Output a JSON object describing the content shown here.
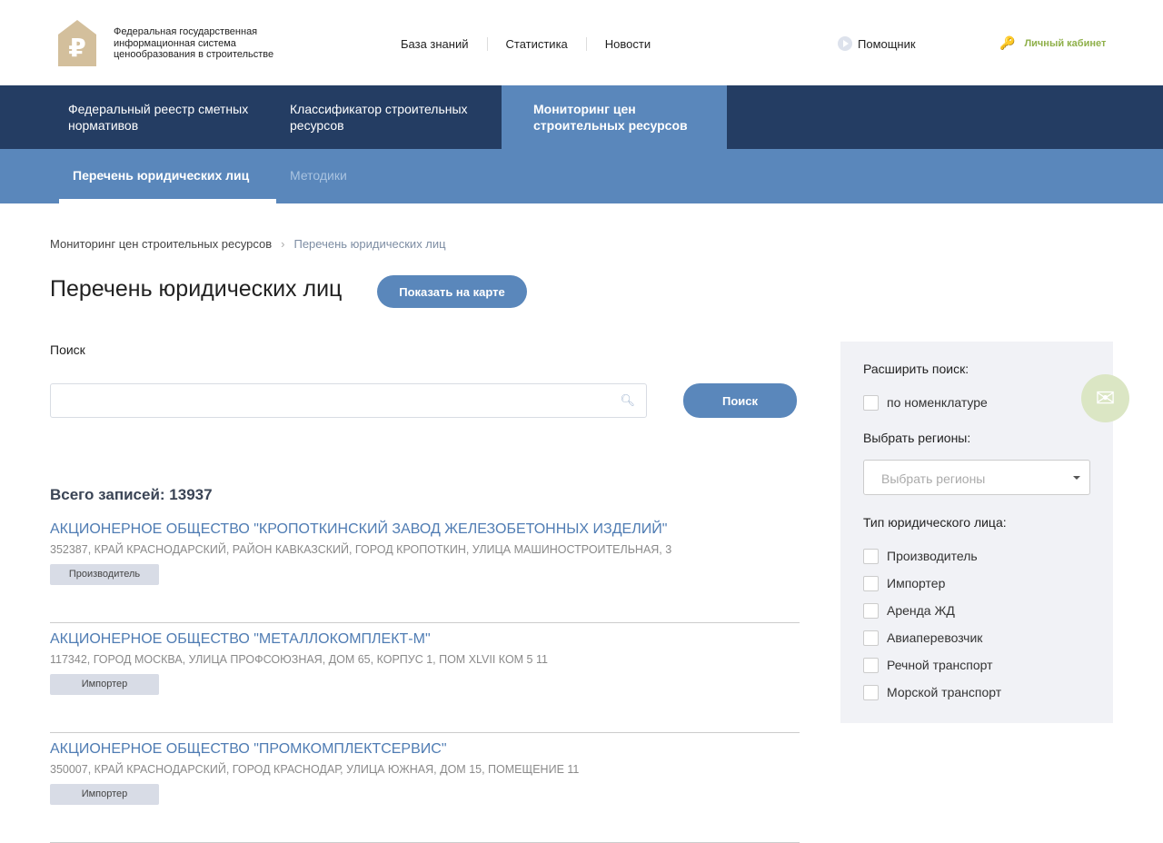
{
  "header": {
    "logo_text": "Федеральная государственная информационная система ценообразования в строительстве",
    "links": [
      "База знаний",
      "Статистика",
      "Новости"
    ],
    "helper": "Помощник",
    "cabinet": "Личный кабинет"
  },
  "nav": {
    "main": [
      "Федеральный реестр сметных нормативов",
      "Классификатор строительных ресурсов",
      "Мониторинг цен строительных ресурсов"
    ],
    "sub": [
      "Перечень юридических лиц",
      "Методики"
    ]
  },
  "breadcrumb": [
    "Мониторинг цен строительных ресурсов",
    "Перечень юридических лиц"
  ],
  "page": {
    "title": "Перечень юридических лиц",
    "map_button": "Показать на карте",
    "search_label": "Поиск",
    "search_value": "",
    "search_button": "Поиск",
    "total": "Всего записей: 13937"
  },
  "items": [
    {
      "title": "АКЦИОНЕРНОЕ ОБЩЕСТВО \"КРОПОТКИНСКИЙ ЗАВОД ЖЕЛЕЗОБЕТОННЫХ ИЗДЕЛИЙ\"",
      "address": "352387, КРАЙ КРАСНОДАРСКИЙ, РАЙОН КАВКАЗСКИЙ, ГОРОД КРОПОТКИН, УЛИЦА МАШИНОСТРОИТЕЛЬНАЯ, 3",
      "type": "Производитель"
    },
    {
      "title": "АКЦИОНЕРНОЕ ОБЩЕСТВО \"МЕТАЛЛОКОМПЛЕКТ-М\"",
      "address": "117342, ГОРОД МОСКВА, УЛИЦА ПРОФСОЮЗНАЯ, ДОМ 65, КОРПУС 1, ПОМ XLVII КОМ 5 11",
      "type": "Импортер"
    },
    {
      "title": "АКЦИОНЕРНОЕ ОБЩЕСТВО \"ПРОМКОМПЛЕКТСЕРВИС\"",
      "address": "350007, КРАЙ КРАСНОДАРСКИЙ, ГОРОД КРАСНОДАР, УЛИЦА ЮЖНАЯ, ДОМ 15, ПОМЕЩЕНИЕ 11",
      "type": "Импортер"
    }
  ],
  "sidebar": {
    "expand": "Расширить поиск:",
    "by_nomenclature": "по номенклатуре",
    "regions_label": "Выбрать регионы:",
    "regions_placeholder": "Выбрать регионы",
    "type_label": "Тип юридического лица:",
    "types": [
      "Производитель",
      "Импортер",
      "Аренда ЖД",
      "Авиаперевозчик",
      "Речной транспорт",
      "Морской транспорт"
    ]
  }
}
